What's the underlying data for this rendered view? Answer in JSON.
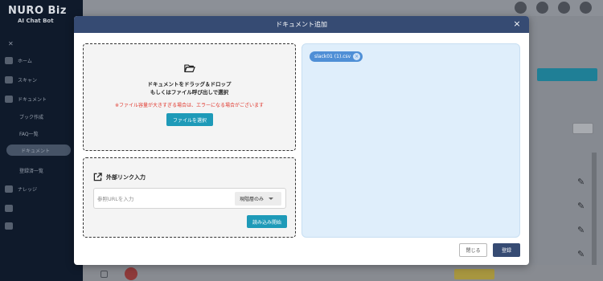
{
  "app": {
    "logo": "NURO Biz",
    "logo_sub": "AI Chat Bot",
    "nav_items": [
      "ホーム",
      "スキャン",
      "ドキュメント",
      "ブック作成",
      "FAQ一覧",
      "ドキュメント",
      "登録済一覧",
      "ナレッジ"
    ]
  },
  "modal": {
    "title": "ドキュメント追加",
    "close_glyph": "×",
    "dropzone": {
      "line1": "ドキュメントをドラッグ＆ドロップ",
      "line2": "もしくはファイル呼び出しで選択",
      "warning": "※ファイル容量が大きすぎる場合は、エラーになる場合がございます",
      "select_button": "ファイルを選択"
    },
    "external_link": {
      "heading": "外部リンク入力",
      "url_placeholder": "参照URLを入力",
      "scope_value": "現階層のみ",
      "load_button": "読み込み開始"
    },
    "files": [
      {
        "name": "slack01 (1).csv"
      }
    ],
    "footer": {
      "close_label": "閉じる",
      "register_label": "登録"
    }
  },
  "colors": {
    "header": "#364b73",
    "accent": "#1e9ab8",
    "warning": "#e0362c",
    "chip": "#4f8fd6",
    "filelist_bg": "#dfeefb"
  }
}
